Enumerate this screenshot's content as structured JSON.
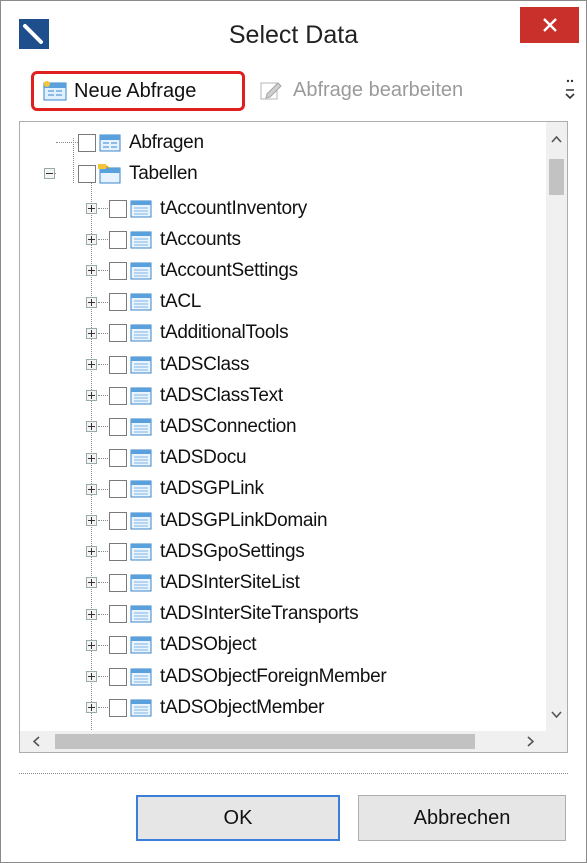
{
  "window": {
    "title": "Select Data"
  },
  "toolbar": {
    "new_query_label": "Neue Abfrage",
    "edit_query_label": "Abfrage bearbeiten"
  },
  "tree": {
    "root_items": [
      {
        "label": "Abfragen",
        "icon": "query-icon"
      },
      {
        "label": "Tabellen",
        "icon": "table-folder-icon"
      }
    ],
    "tables": [
      "tAccountInventory",
      "tAccounts",
      "tAccountSettings",
      "tACL",
      "tAdditionalTools",
      "tADSClass",
      "tADSClassText",
      "tADSConnection",
      "tADSDocu",
      "tADSGPLink",
      "tADSGPLinkDomain",
      "tADSGpoSettings",
      "tADSInterSiteList",
      "tADSInterSiteTransports",
      "tADSObject",
      "tADSObjectForeignMember",
      "tADSObjectMember"
    ]
  },
  "buttons": {
    "ok": "OK",
    "cancel": "Abbrechen"
  },
  "colors": {
    "close": "#c9302c",
    "highlight": "#e02020",
    "focus": "#3c7fd9"
  }
}
